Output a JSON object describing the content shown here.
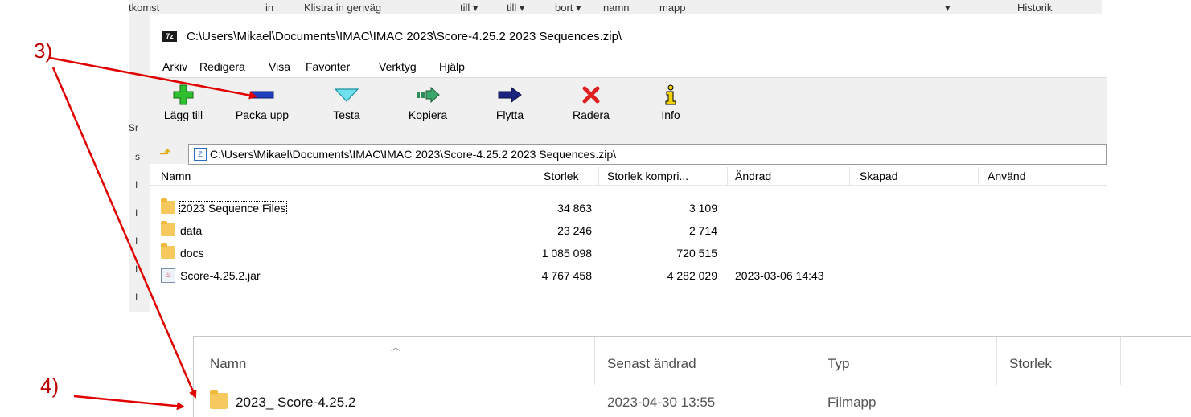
{
  "background_strip": {
    "items": [
      "tkomst",
      "in",
      "Klistra in genväg",
      "till ▾",
      "till ▾",
      "bort ▾",
      "namn",
      "mapp",
      "▾",
      "Historik"
    ],
    "left_letters": [
      "Sr",
      "s",
      "I",
      "I",
      "I",
      "I",
      "I"
    ]
  },
  "window": {
    "title_icon": "7z",
    "title": "C:\\Users\\Mikael\\Documents\\IMAC\\IMAC 2023\\Score-4.25.2 2023 Sequences.zip\\",
    "menu": [
      "Arkiv",
      "Redigera",
      "Visa",
      "Favoriter",
      "Verktyg",
      "Hjälp"
    ],
    "toolbar": [
      {
        "label": "Lägg till",
        "icon": "plus-icon",
        "color": "#2fbf2f"
      },
      {
        "label": "Packa upp",
        "icon": "minus-icon",
        "color": "#1f3fbf"
      },
      {
        "label": "Testa",
        "icon": "check-chevron-icon",
        "color": "#26c6da"
      },
      {
        "label": "Kopiera",
        "icon": "copy-arrow-icon",
        "color": "#2e8b57"
      },
      {
        "label": "Flytta",
        "icon": "move-arrow-icon",
        "color": "#1a237e"
      },
      {
        "label": "Radera",
        "icon": "delete-x-icon",
        "color": "#e02020"
      },
      {
        "label": "Info",
        "icon": "info-icon",
        "color": "#e6c200"
      }
    ],
    "address": "C:\\Users\\Mikael\\Documents\\IMAC\\IMAC 2023\\Score-4.25.2 2023 Sequences.zip\\",
    "columns": [
      "Namn",
      "Storlek",
      "Storlek kompri...",
      "Ändrad",
      "Skapad",
      "Använd"
    ],
    "rows": [
      {
        "name": "2023 Sequence Files",
        "size": "34 863",
        "packed": "3 109",
        "modified": "",
        "type": "folder"
      },
      {
        "name": "data",
        "size": "23 246",
        "packed": "2 714",
        "modified": "",
        "type": "folder"
      },
      {
        "name": "docs",
        "size": "1 085 098",
        "packed": "720 515",
        "modified": "",
        "type": "folder"
      },
      {
        "name": "Score-4.25.2.jar",
        "size": "4 767 458",
        "packed": "4 282 029",
        "modified": "2023-03-06 14:43",
        "type": "jar"
      }
    ]
  },
  "explorer": {
    "columns": [
      "Namn",
      "Senast ändrad",
      "Typ",
      "Storlek"
    ],
    "rows": [
      {
        "name": "2023_ Score-4.25.2",
        "modified": "2023-04-30 13:55",
        "type": "Filmapp",
        "size": ""
      }
    ]
  },
  "annotations": {
    "step3": "3)",
    "step4": "4)",
    "arrow_color": "#e00000"
  }
}
